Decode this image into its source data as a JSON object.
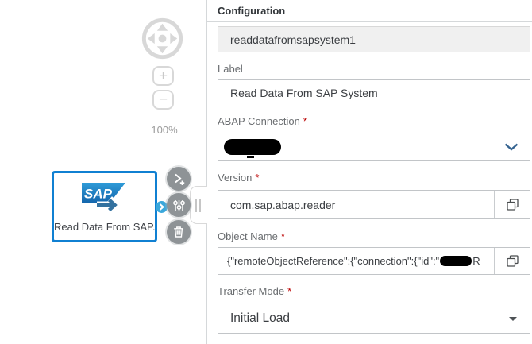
{
  "canvas": {
    "zoom_level": "100%",
    "zoom_in_glyph": "+",
    "zoom_out_glyph": "−",
    "node": {
      "logo_text": "SAP",
      "label": "Read Data From SAP..."
    }
  },
  "panel": {
    "title": "Configuration",
    "operator_id": {
      "value": "readdatafromsapsystem1"
    },
    "label_field": {
      "label": "Label",
      "value": "Read Data From SAP System"
    },
    "abap_connection": {
      "label": "ABAP Connection",
      "required": "*",
      "redacted": true
    },
    "version": {
      "label": "Version",
      "required": "*",
      "value": "com.sap.abap.reader"
    },
    "object_name": {
      "label": "Object Name",
      "required": "*",
      "value_prefix": "{\"remoteObjectReference\":{\"connection\":{\"id\":\"",
      "redacted": true,
      "value_suffix": "R"
    },
    "transfer_mode": {
      "label": "Transfer Mode",
      "required": "*",
      "value": "Initial Load"
    }
  }
}
